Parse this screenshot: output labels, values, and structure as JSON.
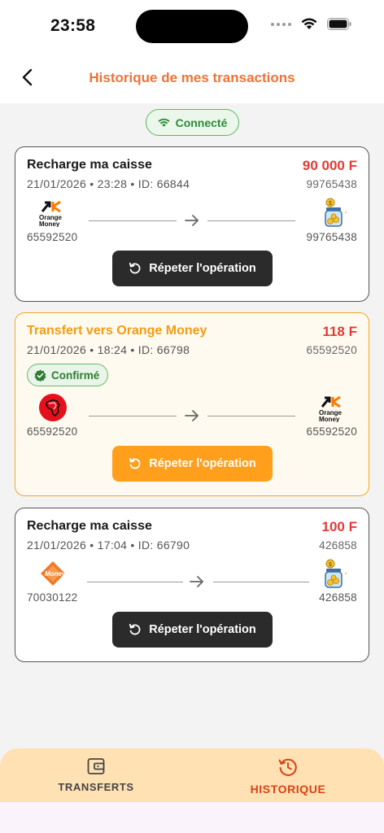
{
  "status_bar": {
    "time": "23:58"
  },
  "header": {
    "title": "Historique de mes transactions"
  },
  "connection": {
    "label": "Connecté"
  },
  "transactions": [
    {
      "title": "Recharge ma caisse",
      "amount": "90 000 F",
      "meta": "21/01/2026 • 23:28 • ID: 66844",
      "reference": "99765438",
      "from_logo": "orange-money-logo",
      "from_number": "65592520",
      "to_logo": "cash-jar-icon",
      "to_number": "99765438",
      "repeat_label": "Répeter l'opération"
    },
    {
      "title": "Transfert vers Orange Money",
      "amount": "118 F",
      "meta": "21/01/2026 • 18:24 • ID: 66798",
      "reference": "65592520",
      "status": "Confirmé",
      "from_logo": "africa-red-logo",
      "from_number": "65592520",
      "to_logo": "orange-money-logo",
      "to_number": "65592520",
      "repeat_label": "Répeter l'opération"
    },
    {
      "title": "Recharge ma caisse",
      "amount": "100 F",
      "meta": "21/01/2026 • 17:04 • ID: 66790",
      "reference": "426858",
      "from_logo": "moneyx-logo",
      "from_number": "70030122",
      "to_logo": "cash-jar-icon",
      "to_number": "426858",
      "repeat_label": "Répeter l'opération"
    }
  ],
  "logo_text": {
    "orange_money_line1": "Orange",
    "orange_money_line2": "Money",
    "moneyx": "Money"
  },
  "bottom_nav": {
    "transfers_label": "TRANSFERTS",
    "history_label": "HISTORIQUE"
  },
  "colors": {
    "accent": "#ef7336",
    "amount": "#e53935",
    "confirm": "#2e7d32",
    "highlight_border": "#f5a623"
  }
}
